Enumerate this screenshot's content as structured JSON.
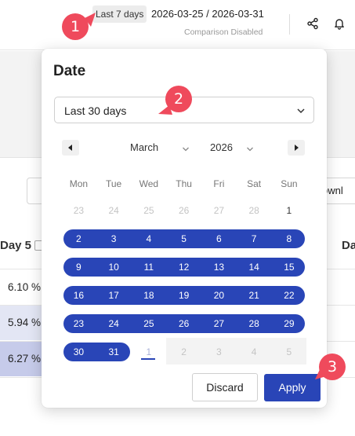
{
  "header": {
    "preset_chip": "Last 7 days",
    "range_text": "2026-03-25 / 2026-03-31",
    "comparison": "Comparison Disabled",
    "icons": [
      "share-icon",
      "bell-icon"
    ]
  },
  "background": {
    "download_label": "ownl",
    "day_header": "Day 5",
    "day_header_right": "Da",
    "cells": [
      "6.10 %",
      "5.94 %",
      "6.27 %"
    ]
  },
  "popup": {
    "title": "Date",
    "preset_value": "Last 30 days",
    "month": "March",
    "year": "2026",
    "weekdays": [
      "Mon",
      "Tue",
      "Wed",
      "Thu",
      "Fri",
      "Sat",
      "Sun"
    ],
    "weeks": [
      [
        "23",
        "24",
        "25",
        "26",
        "27",
        "28",
        "1"
      ],
      [
        "2",
        "3",
        "4",
        "5",
        "6",
        "7",
        "8"
      ],
      [
        "9",
        "10",
        "11",
        "12",
        "13",
        "14",
        "15"
      ],
      [
        "16",
        "17",
        "18",
        "19",
        "20",
        "21",
        "22"
      ],
      [
        "23",
        "24",
        "25",
        "26",
        "27",
        "28",
        "29"
      ],
      [
        "30",
        "31",
        "1",
        "2",
        "3",
        "4",
        "5"
      ]
    ],
    "discard_label": "Discard",
    "apply_label": "Apply"
  },
  "steps": [
    "1",
    "2",
    "3"
  ],
  "colors": {
    "accent": "#2945b7",
    "step_marker": "#ef4a5c",
    "out_of_month_text": "#c4c4c4"
  }
}
